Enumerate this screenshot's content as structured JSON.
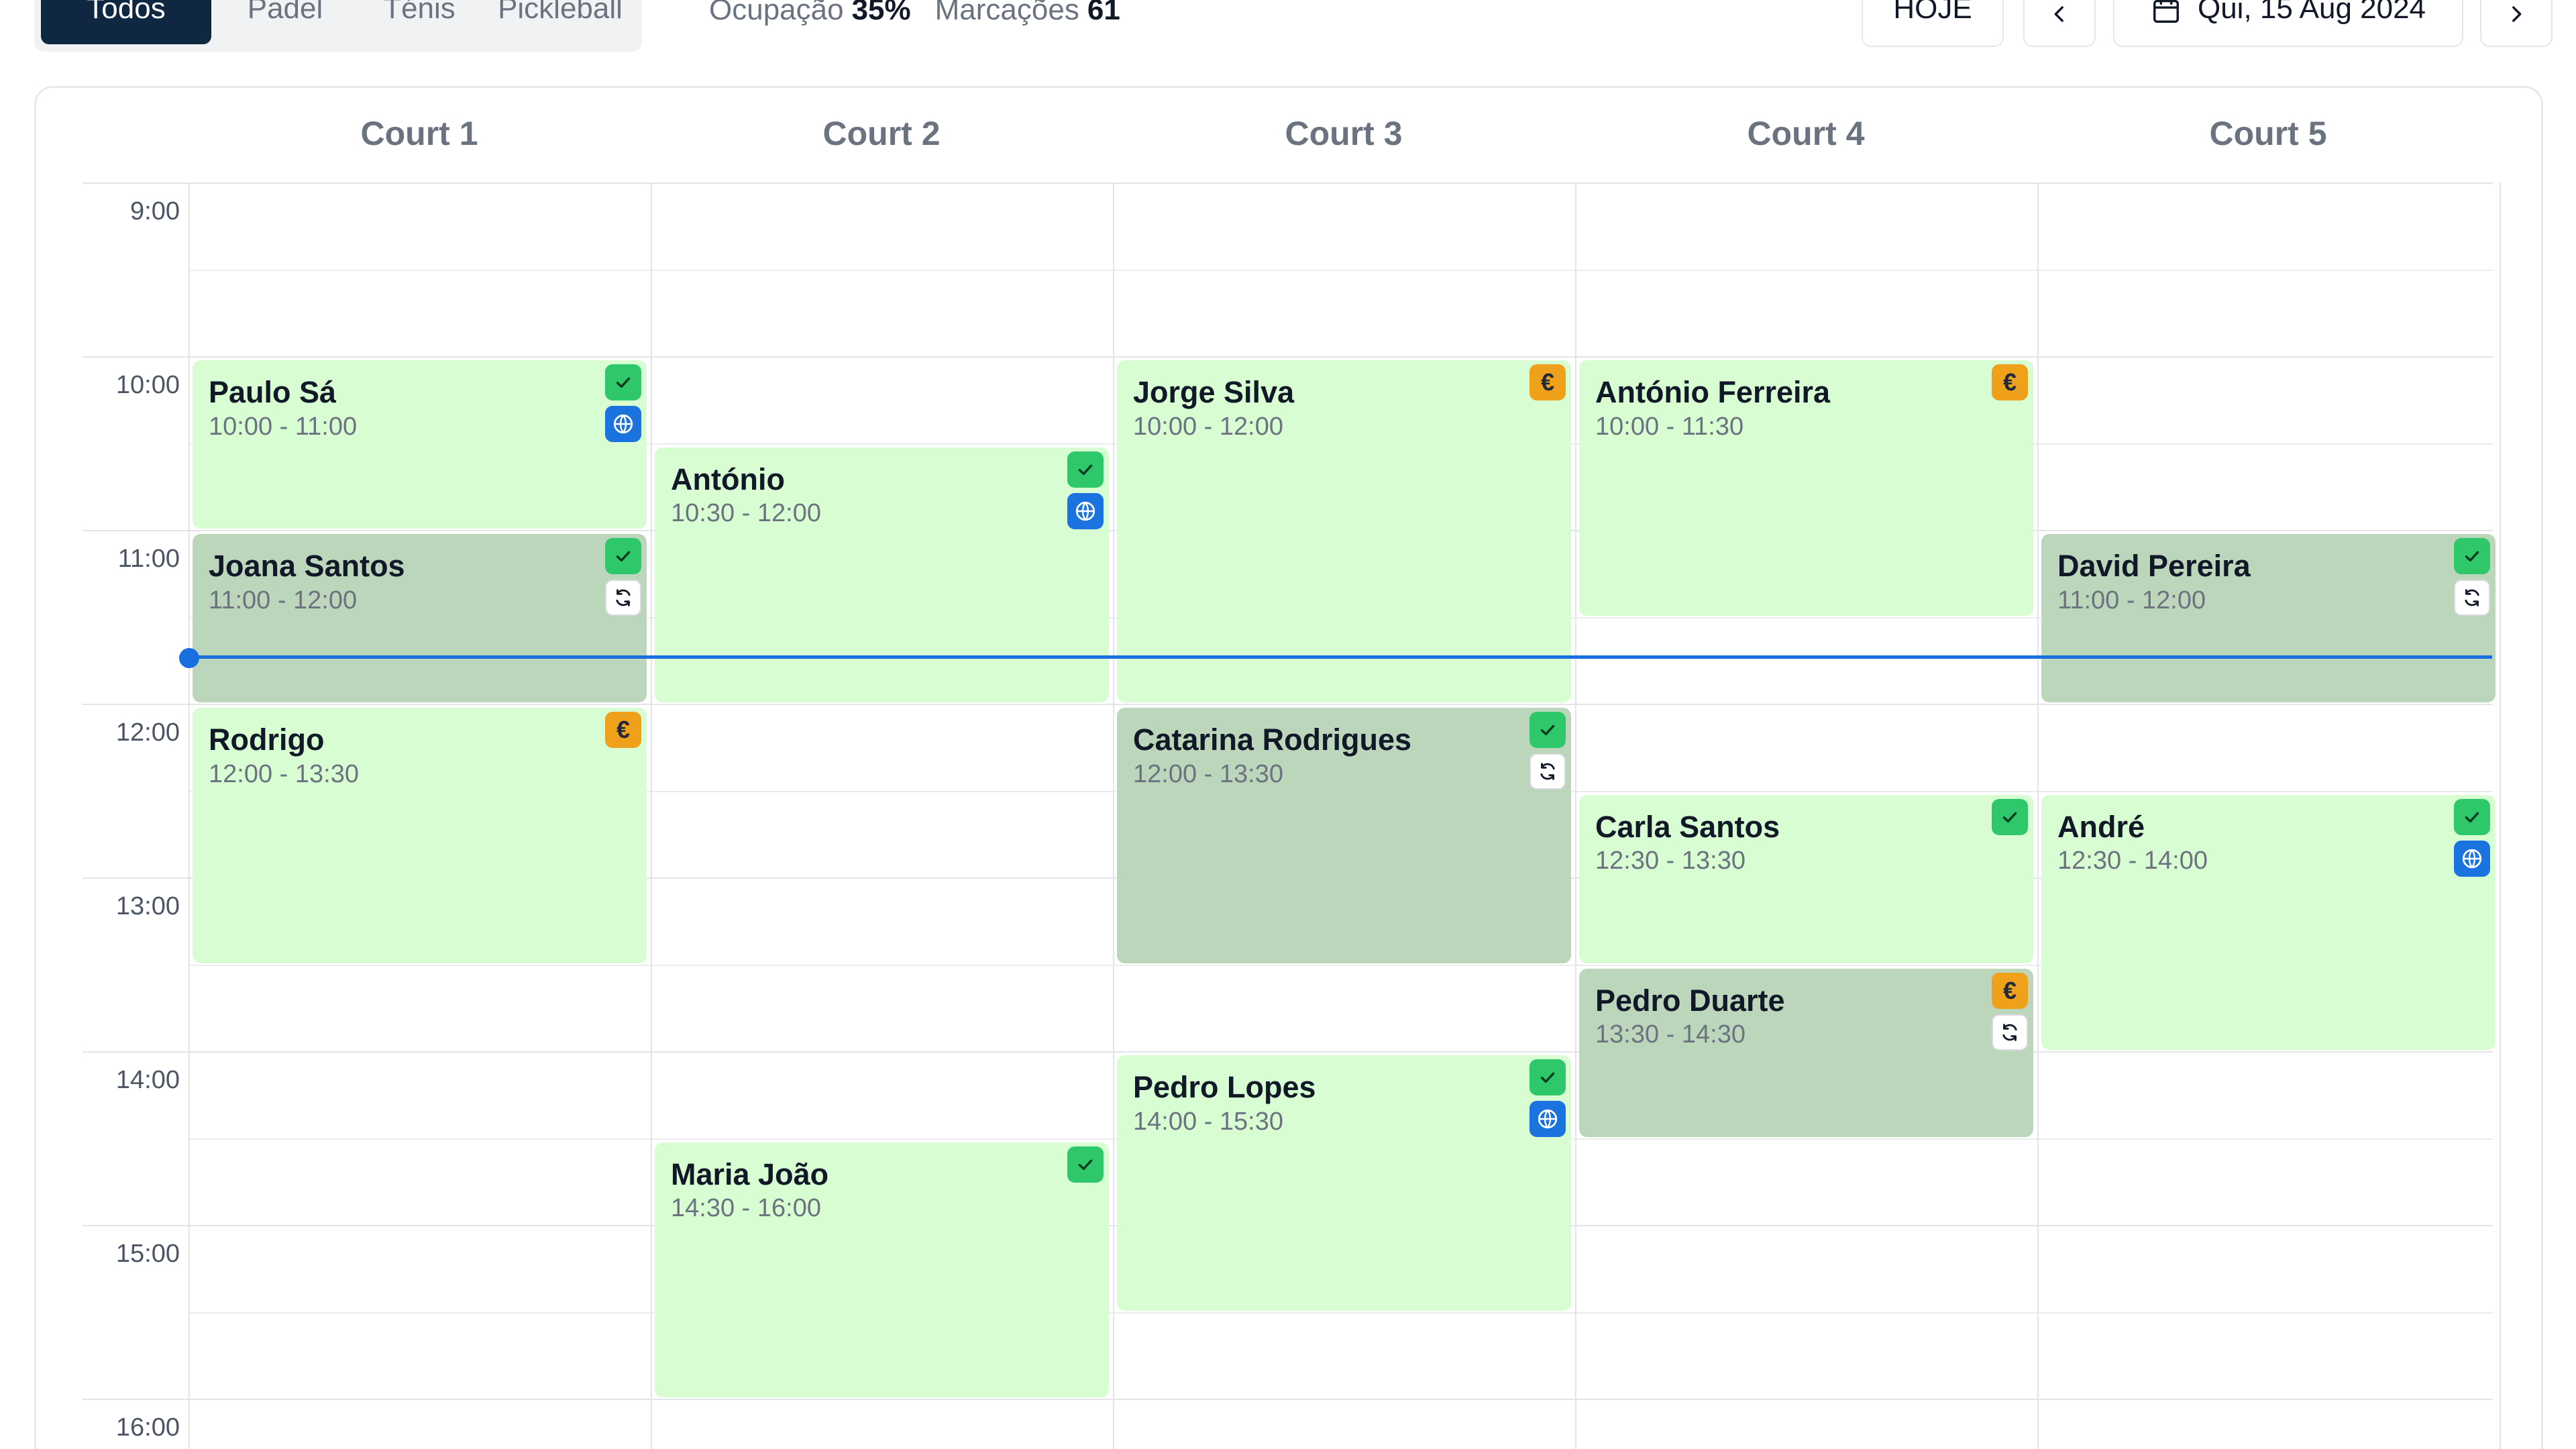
{
  "filters": {
    "tabs": [
      {
        "label": "Todos",
        "active": true
      },
      {
        "label": "Padel",
        "active": false
      },
      {
        "label": "Ténis",
        "active": false
      },
      {
        "label": "Pickleball",
        "active": false
      }
    ]
  },
  "stats": {
    "occupancy_label": "Ocupação",
    "occupancy_value": "35%",
    "bookings_label": "Marcações",
    "bookings_value": "61"
  },
  "nav": {
    "today_label": "HOJE",
    "date_label": "Qui, 15 Aug 2024"
  },
  "courts": [
    "Court 1",
    "Court 2",
    "Court 3",
    "Court 4",
    "Court 5"
  ],
  "time_labels": [
    "9:00",
    "10:00",
    "11:00",
    "12:00",
    "13:00",
    "14:00",
    "15:00",
    "16:00"
  ],
  "bookings": [
    {
      "court": 0,
      "name": "Paulo Sá",
      "time": "10:00 - 11:00",
      "status": "green",
      "badges": [
        "check",
        "globe"
      ]
    },
    {
      "court": 0,
      "name": "Joana Santos",
      "time": "11:00 - 12:00",
      "status": "sage",
      "badges": [
        "check",
        "sync"
      ]
    },
    {
      "court": 0,
      "name": "Rodrigo",
      "time": "12:00 - 13:30",
      "status": "green",
      "badges": [
        "euro"
      ]
    },
    {
      "court": 1,
      "name": "António",
      "time": "10:30 - 12:00",
      "status": "green",
      "badges": [
        "check",
        "globe"
      ]
    },
    {
      "court": 1,
      "name": "Maria João",
      "time": "14:30 - 16:00",
      "status": "green",
      "badges": [
        "check"
      ]
    },
    {
      "court": 2,
      "name": "Jorge Silva",
      "time": "10:00 - 12:00",
      "status": "green",
      "badges": [
        "euro"
      ]
    },
    {
      "court": 2,
      "name": "Catarina Rodrigues",
      "time": "12:00 - 13:30",
      "status": "sage",
      "badges": [
        "check",
        "sync"
      ]
    },
    {
      "court": 2,
      "name": "Pedro Lopes",
      "time": "14:00 - 15:30",
      "status": "green",
      "badges": [
        "check",
        "globe"
      ]
    },
    {
      "court": 3,
      "name": "António Ferreira",
      "time": "10:00 - 11:30",
      "status": "green",
      "badges": [
        "euro"
      ]
    },
    {
      "court": 3,
      "name": "Carla Santos",
      "time": "12:30 - 13:30",
      "status": "green",
      "badges": [
        "check"
      ]
    },
    {
      "court": 3,
      "name": "Pedro Duarte",
      "time": "13:30 - 14:30",
      "status": "sage",
      "badges": [
        "euro",
        "sync"
      ]
    },
    {
      "court": 4,
      "name": "David Pereira",
      "time": "11:00 - 12:00",
      "status": "sage",
      "badges": [
        "check",
        "sync"
      ]
    },
    {
      "court": 4,
      "name": "André",
      "time": "12:30 - 14:00",
      "status": "green",
      "badges": [
        "check",
        "globe"
      ]
    }
  ],
  "icons": {
    "check": "check-icon",
    "globe": "globe-icon",
    "euro": "euro-icon",
    "sync": "sync-icon",
    "calendar": "calendar-icon",
    "prev": "chevron-left-icon",
    "next": "chevron-right-icon"
  },
  "euro_symbol": "€",
  "now_indicator": {
    "time": "11:45"
  },
  "colors": {
    "active_tab": "#0f2741",
    "booking_confirmed": "#d9fdd2",
    "booking_recurring": "#bcd6bc",
    "check_badge": "#2ec86a",
    "globe_badge": "#1b73e0",
    "euro_badge": "#f0a11b",
    "now_line": "#1a6fe0"
  }
}
